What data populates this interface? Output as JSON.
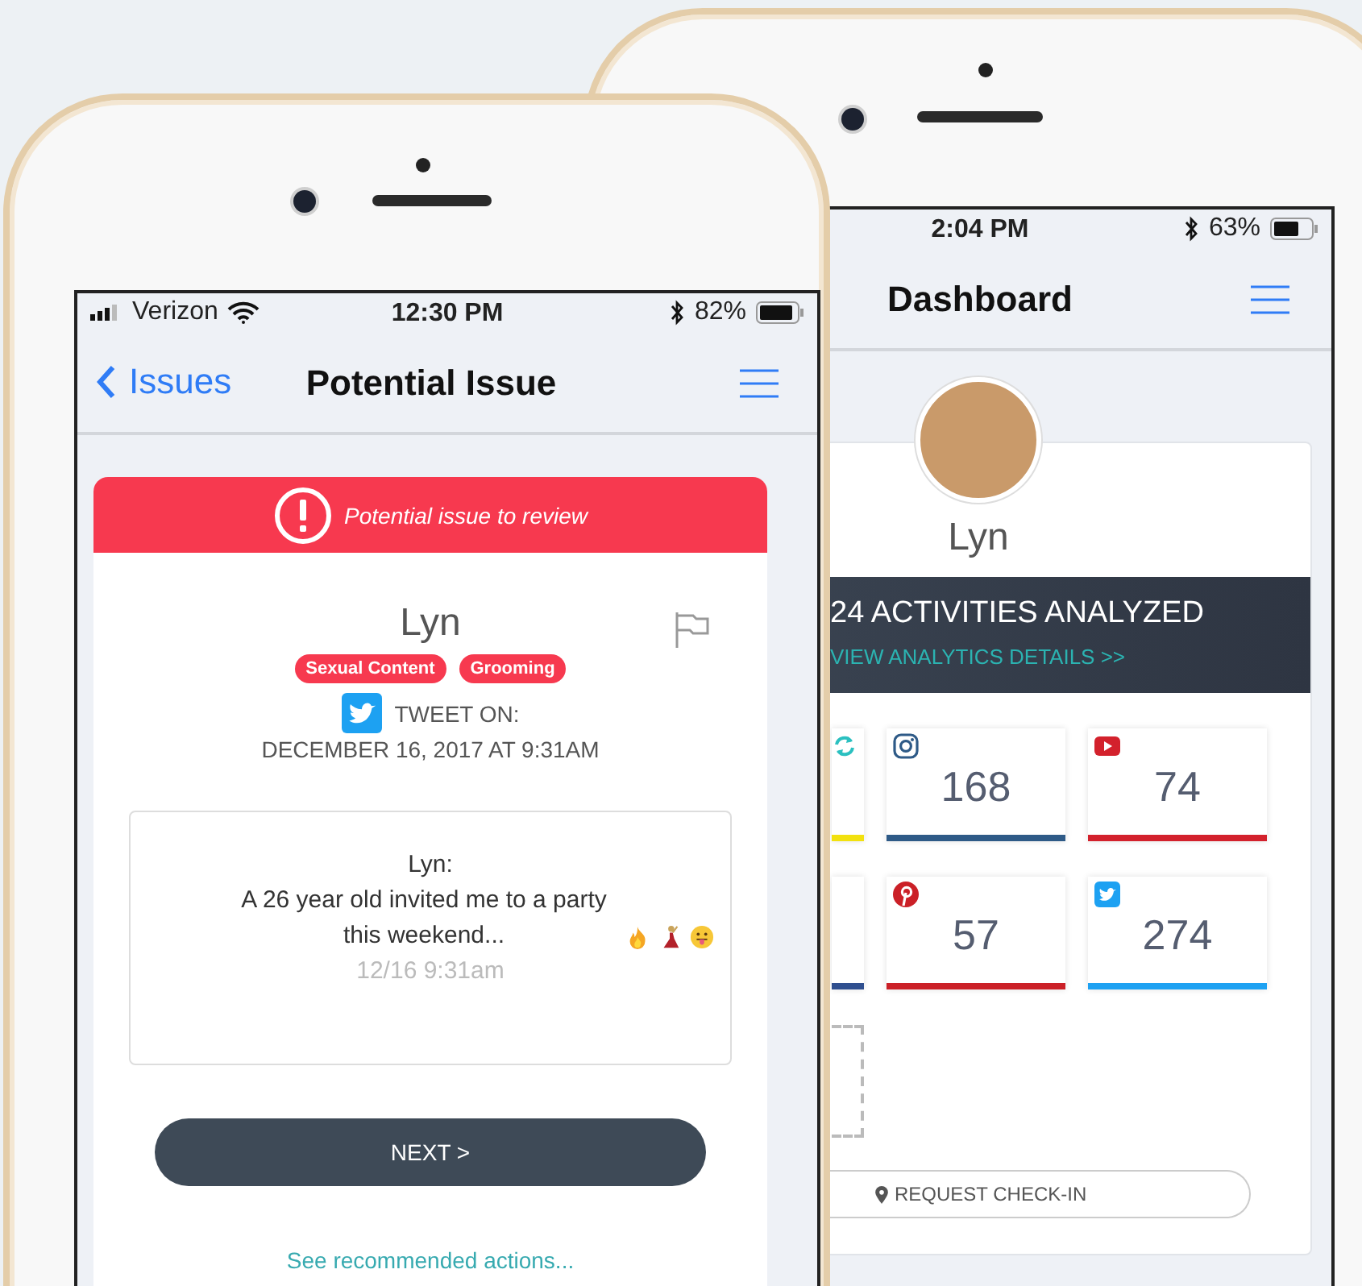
{
  "issue_screen": {
    "status_bar": {
      "carrier": "Verizon",
      "time": "12:30 PM",
      "battery": "82%"
    },
    "nav": {
      "back": "Issues",
      "title": "Potential Issue"
    },
    "alert": {
      "text": "Potential issue to review"
    },
    "person": {
      "name": "Lyn"
    },
    "tags": [
      {
        "label": "Sexual Content"
      },
      {
        "label": "Grooming"
      }
    ],
    "post": {
      "label": "TWEET ON:",
      "date": "DECEMBER 16, 2017 AT 9:31AM"
    },
    "message": {
      "author": "Lyn:",
      "text": "A 26 year old invited me to a party this weekend...",
      "time": "12/16 9:31am"
    },
    "next_button": "NEXT >",
    "link": "See recommended actions..."
  },
  "dashboard_screen": {
    "status_bar": {
      "time": "2:04 PM",
      "battery": "63%"
    },
    "nav": {
      "title": "Dashboard"
    },
    "profile": {
      "name": "Lyn"
    },
    "summary": {
      "text": "24 ACTIVITIES ANALYZED",
      "link": "VIEW ANALYTICS DETAILS >>"
    },
    "tiles": [
      {
        "kind": "sync",
        "color": "#f2e10f"
      },
      {
        "kind": "instagram",
        "count": "168",
        "color": "#2e5a87"
      },
      {
        "kind": "youtube",
        "count": "74",
        "color": "#d3212c"
      },
      {
        "kind": "none",
        "color": "#2f4f8f"
      },
      {
        "kind": "pinterest",
        "count": "57",
        "color": "#cb2027"
      },
      {
        "kind": "twitter",
        "count": "274",
        "color": "#1da1f2"
      }
    ],
    "request_button": "REQUEST CHECK-IN"
  }
}
